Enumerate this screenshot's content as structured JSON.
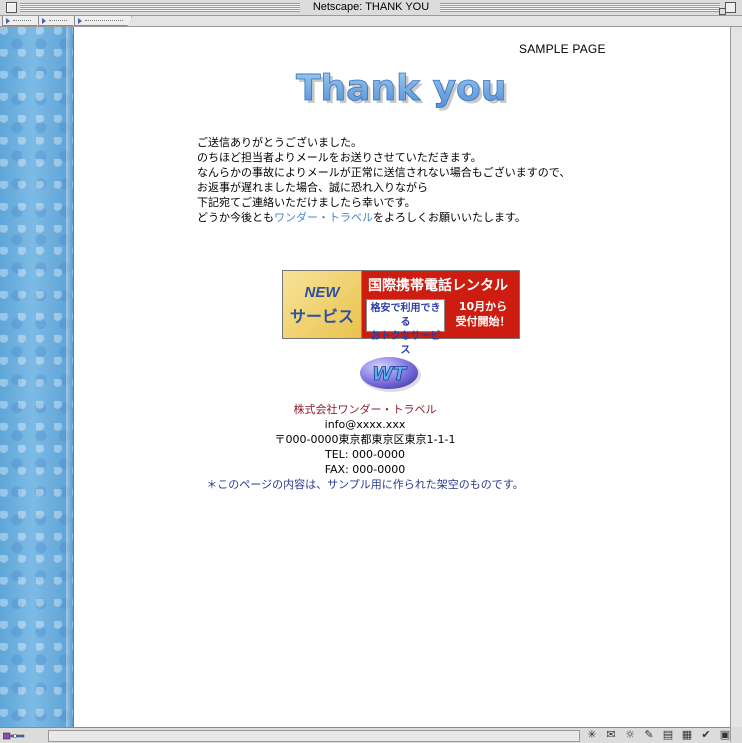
{
  "window": {
    "title": "Netscape: THANK YOU"
  },
  "page": {
    "sample_label": "SAMPLE PAGE",
    "heading": "Thank you!",
    "message_lines": [
      "ご送信ありがとうございました。",
      "のちほど担当者よりメールをお送りさせていただきます。",
      "なんらかの事故によりメールが正常に送信されない場合もございますので、",
      "お返事が遅れました場合、誠に恐れ入りながら",
      "下記宛てご連絡いただけましたら幸いです。"
    ],
    "last_line": {
      "prefix": "どうか今後とも",
      "link": "ワンダー・トラベル",
      "suffix": "をよろしくお願いいたします。"
    }
  },
  "banner": {
    "new_label": "NEW",
    "service_label": "サービス",
    "headline": "国際携帯電話レンタル",
    "tag_line1": "格安で利用できる",
    "tag_line2": "おトクなサービス",
    "date_line1": "10月から",
    "date_line2": "受付開始！"
  },
  "logo": {
    "text": "WT"
  },
  "footer": {
    "company": "株式会社ワンダー・トラベル",
    "email": "info@xxxx.xxx",
    "address": "〒000-0000東京都東京区東京1-1-1",
    "tel": "TEL: 000-0000",
    "fax": "FAX: 000-0000",
    "notice": "＊このページの内容は、サンプル用に作られた架空のものです。"
  },
  "colors": {
    "sidebar": "#6eb0e0",
    "link": "#4a86c6",
    "company": "#8a1f2f",
    "notice": "#2a3b8f",
    "banner_red": "#cc1d10",
    "banner_gold": "#e9c24b"
  },
  "status_icons": [
    "security-icon",
    "component-bar-navigator-icon",
    "mail-icon",
    "discussions-icon",
    "composer-icon",
    "bookmark-icon",
    "edit-icon",
    "communicator-icon"
  ]
}
